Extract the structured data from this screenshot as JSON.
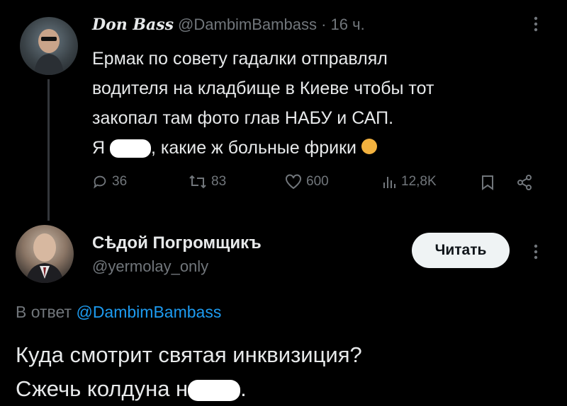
{
  "original_tweet": {
    "author_name": "Don Bass",
    "author_handle": "@DambimBambass",
    "time": "· 16 ч.",
    "text_lines": [
      "Ермак по совету гадалки отправлял",
      "водителя на кладбище в Киеве чтобы тот",
      "закопал там фото глав НАБУ и САП."
    ],
    "last_line_prefix": "Я",
    "last_line_suffix": ", какие ж больные фрики",
    "stats": {
      "replies": "36",
      "retweets": "83",
      "likes": "600",
      "views": "12,8K"
    },
    "more_icon": "more-vertical-icon"
  },
  "reply_tweet": {
    "author_name": "Сѣдой Погромщикъ",
    "author_handle": "@yermolay_only",
    "follow_button": "Читать",
    "reply_to_prefix": "В ответ",
    "reply_to_mention": "@DambimBambass",
    "text_line_1": "Куда смотрит святая инквизиция?",
    "text_line_2_prefix": "Сжечь колдуна н",
    "text_line_2_suffix": "."
  },
  "colors": {
    "background": "#000000",
    "text": "#e7e9ea",
    "muted": "#71767b",
    "link": "#1d9bf0"
  }
}
